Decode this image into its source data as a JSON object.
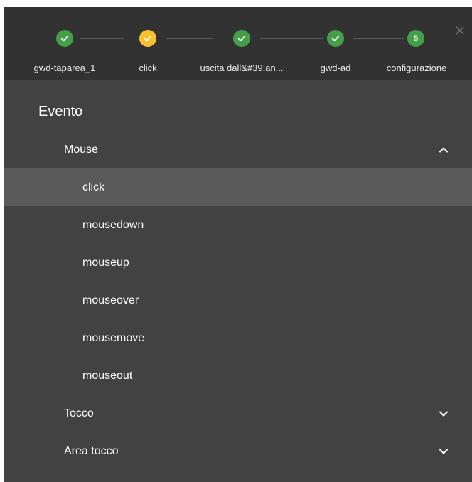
{
  "stepper": {
    "steps": [
      {
        "label": "gwd-taparea_1",
        "state": "done"
      },
      {
        "label": "click",
        "state": "current"
      },
      {
        "label": "uscita dall&#39;an...",
        "state": "done"
      },
      {
        "label": "gwd-ad",
        "state": "done"
      },
      {
        "label": "configurazione",
        "state": "numbered",
        "number": "5"
      }
    ],
    "close_icon": "close-icon"
  },
  "panel": {
    "title": "Evento",
    "groups": [
      {
        "label": "Mouse",
        "expanded": true,
        "icon": "chevron-up-icon",
        "items": [
          {
            "label": "click",
            "selected": true
          },
          {
            "label": "mousedown",
            "selected": false
          },
          {
            "label": "mouseup",
            "selected": false
          },
          {
            "label": "mouseover",
            "selected": false
          },
          {
            "label": "mousemove",
            "selected": false
          },
          {
            "label": "mouseout",
            "selected": false
          }
        ]
      },
      {
        "label": "Tocco",
        "expanded": false,
        "icon": "chevron-down-icon"
      },
      {
        "label": "Area tocco",
        "expanded": false,
        "icon": "chevron-down-icon"
      }
    ]
  },
  "colors": {
    "dialog_bg": "#424242",
    "header_bg": "#323232",
    "done": "#43a047",
    "current": "#fbc02d",
    "selected_row": "#5a5a5a"
  }
}
